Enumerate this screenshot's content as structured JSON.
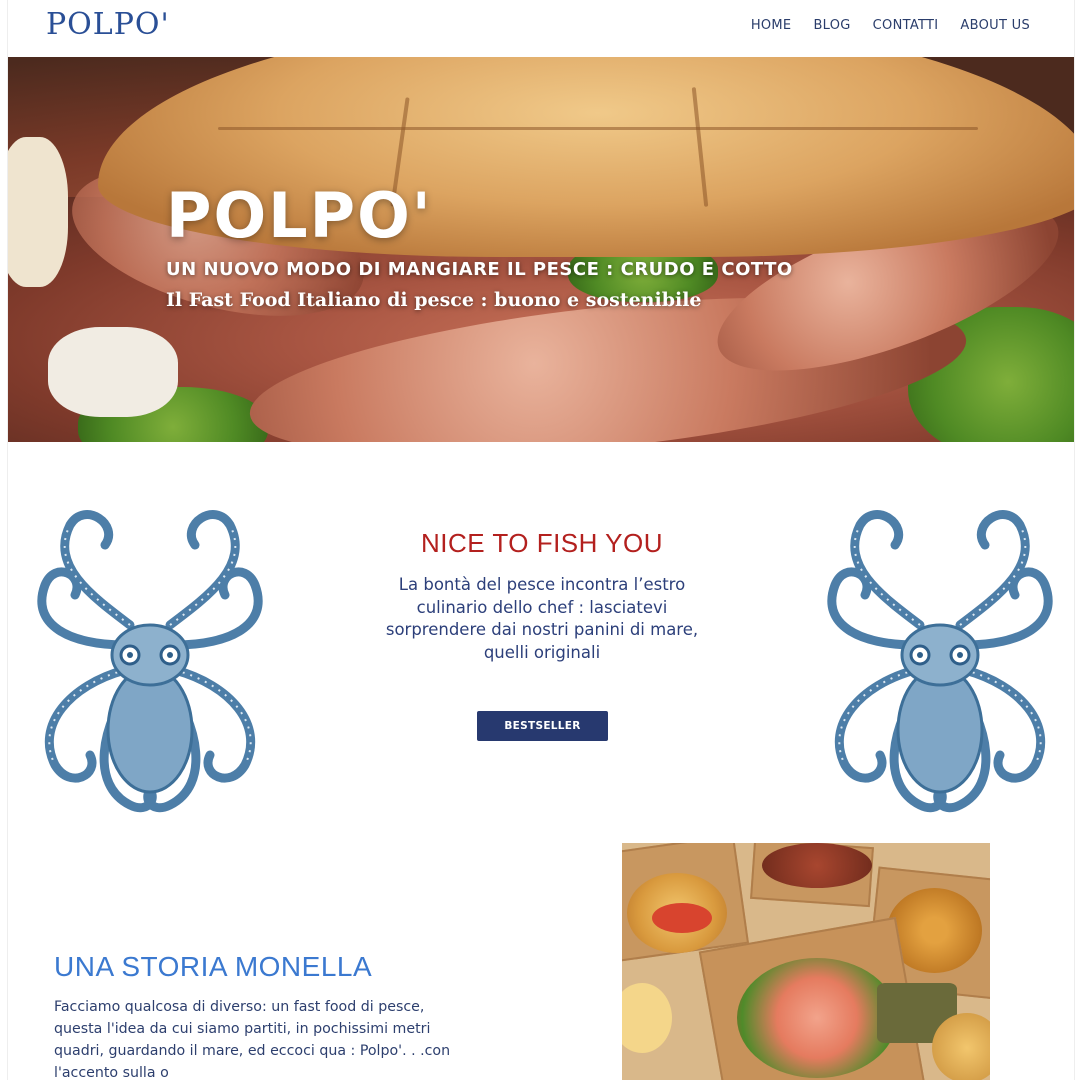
{
  "header": {
    "logo": "POLPO'",
    "nav": [
      "HOME",
      "BLOG",
      "CONTATTI",
      "ABOUT US"
    ]
  },
  "hero": {
    "title": "POLPO'",
    "subtitle": "UN NUOVO MODO DI MANGIARE IL PESCE : CRUDO E COTTO",
    "tagline": "Il Fast Food Italiano di pesce : buono e sostenibile"
  },
  "intro": {
    "title": "NICE TO FISH YOU",
    "text_lines": [
      "La bontà del pesce incontra l’estro",
      "culinario dello chef : lasciatevi",
      "sorprendere dai nostri panini di mare,",
      "quelli originali"
    ],
    "button": "BESTSELLER"
  },
  "story": {
    "title": "UNA STORIA MONELLA",
    "text_lines": [
      "Facciamo qualcosa di diverso: un fast food di pesce,",
      "questa l'idea da cui siamo partiti, in pochissimi metri",
      "quadri, guardando il mare, ed eccoci qua : Polpo'. . .con",
      "l'accento sulla o"
    ]
  },
  "colors": {
    "brand_blue": "#2a4f96",
    "accent_red": "#b3201e",
    "story_blue": "#3b79d0",
    "button_navy": "#27396f",
    "octopus_blue": "#4d7ea8"
  },
  "icons": [
    "octopus-illustration-icon"
  ]
}
